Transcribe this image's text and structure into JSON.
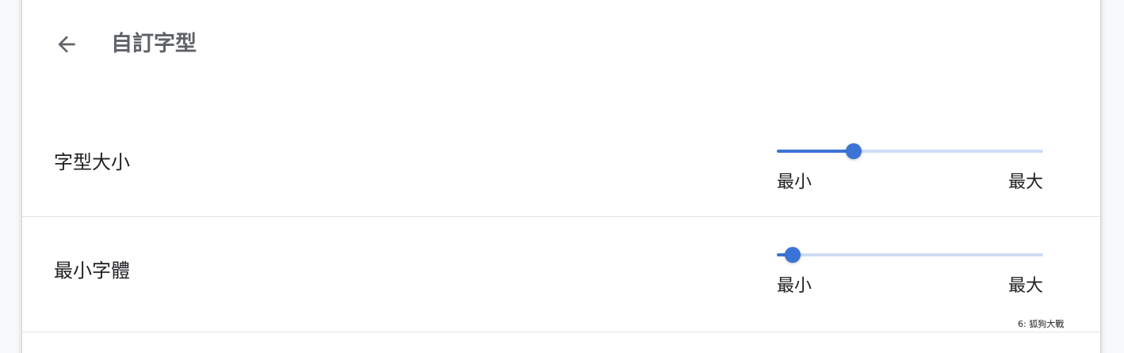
{
  "header": {
    "title": "自訂字型",
    "back_icon": "arrow-back-icon"
  },
  "settings": [
    {
      "label": "字型大小",
      "slider": {
        "value_fraction": 0.29,
        "min_label": "最小",
        "max_label": "最大"
      }
    },
    {
      "label": "最小字體",
      "slider": {
        "value_fraction": 0.06,
        "min_label": "最小",
        "max_label": "最大"
      }
    }
  ],
  "footer_note": "6: 狐狗大戰",
  "colors": {
    "accent": "#3b73d6",
    "track_inactive": "#cfdcf4",
    "title_text": "#5f6368",
    "body_text": "#202124"
  }
}
